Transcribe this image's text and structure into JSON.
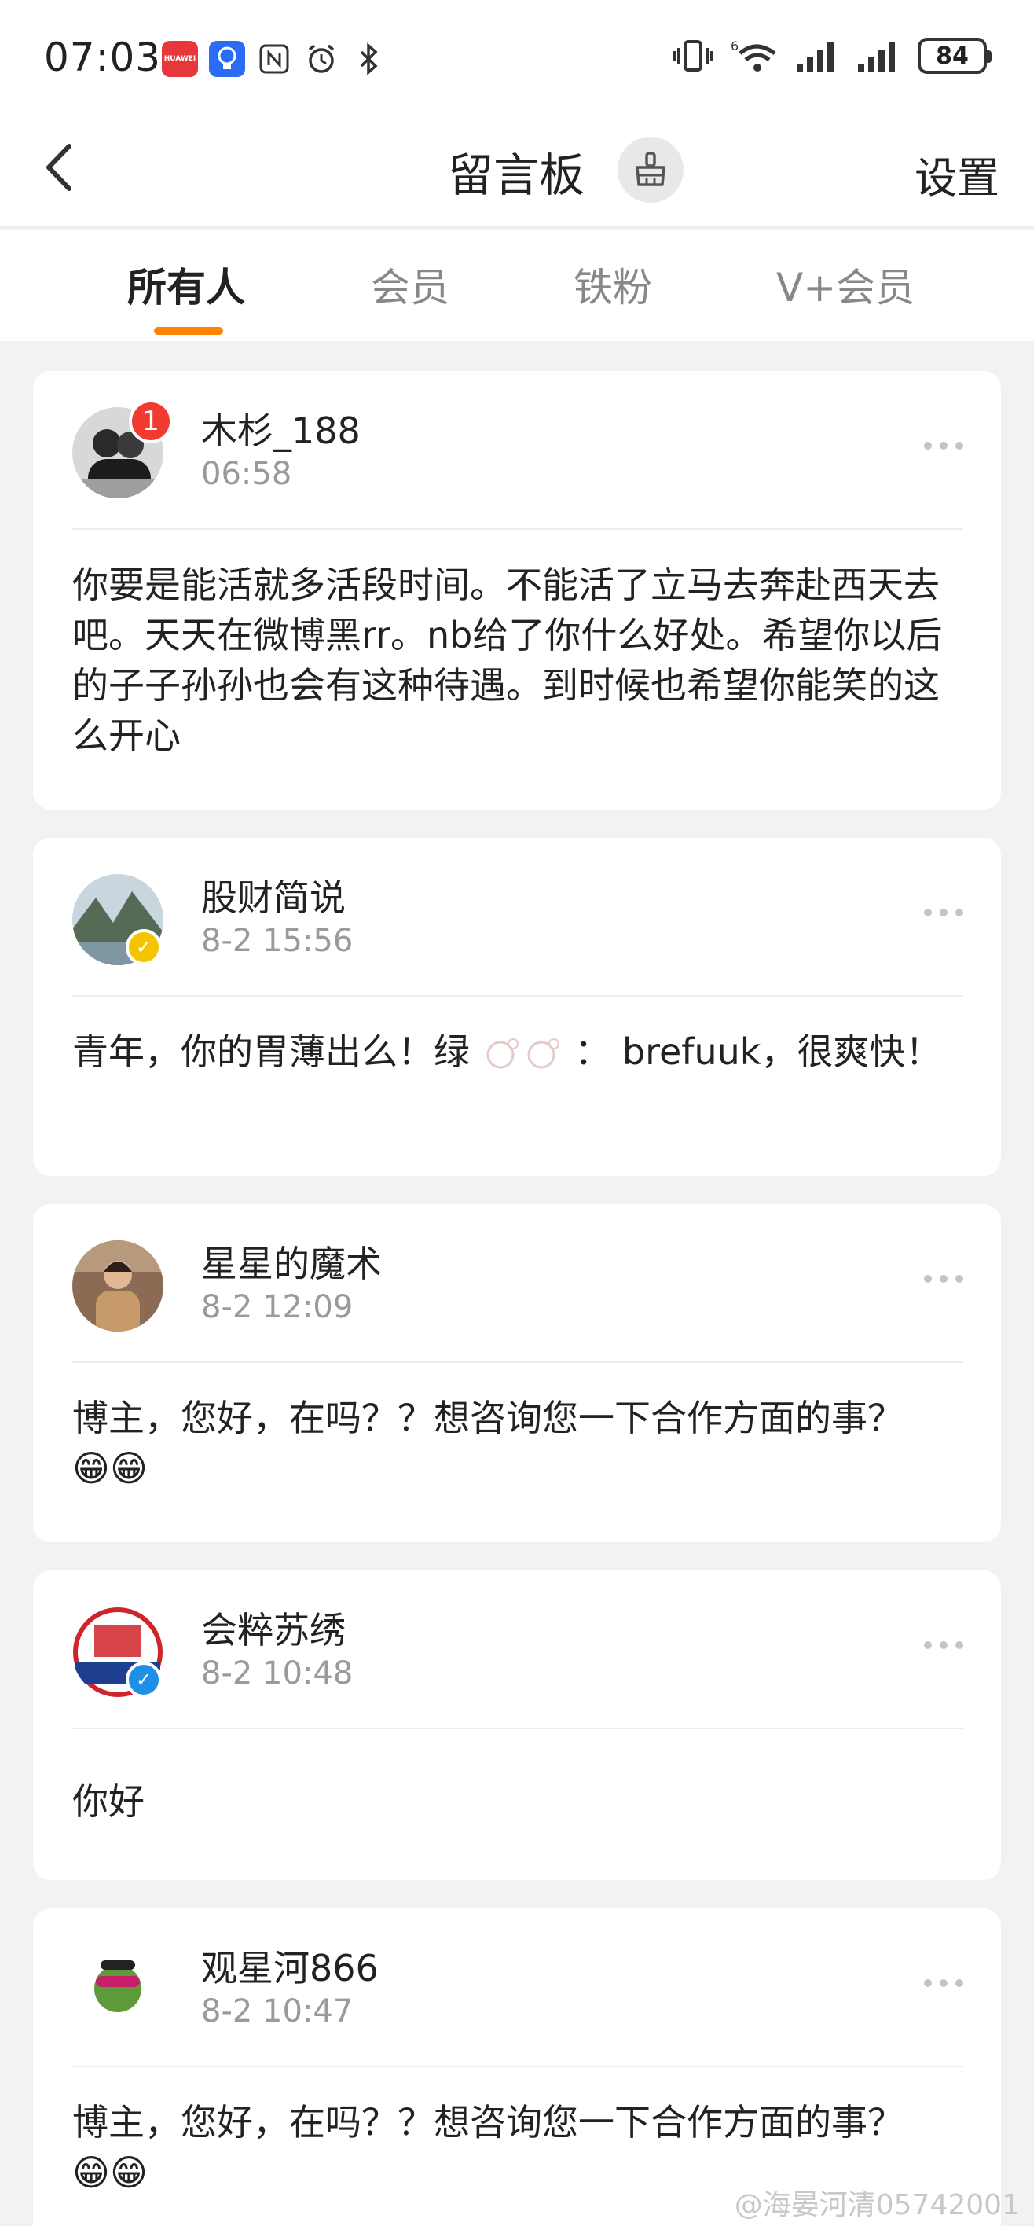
{
  "status_bar": {
    "time": "07:03",
    "app_icons": [
      "huawei-icon",
      "lightbulb-icon",
      "nfc-icon",
      "alarm-icon",
      "bluetooth-icon"
    ],
    "huawei_label": "HUAWEI",
    "battery": "84"
  },
  "header": {
    "title": "留言板",
    "settings_label": "设置"
  },
  "tabs": [
    {
      "label": "所有人",
      "active": true
    },
    {
      "label": "会员",
      "active": false
    },
    {
      "label": "铁粉",
      "active": false
    },
    {
      "label": "V+会员",
      "active": false
    }
  ],
  "messages": [
    {
      "name": "木杉_188",
      "time": "06:58",
      "badge": "1",
      "text": "你要是能活就多活段时间。不能活了立马去奔赴西天去吧。天天在微博黑rr。nb给了你什么好处。希望你以后的子子孙孙也会有这种待遇。到时候也希望你能笑的这么开心"
    },
    {
      "name": "股财简说",
      "time": "8-2 15:56",
      "text": "青年，你的胃薄出么！绿",
      "text_after": "：   brefuuk，很爽快！"
    },
    {
      "name": "星星的魔术",
      "time": "8-2 12:09",
      "text": "博主，您好，在吗？？想咨询您一下合作方面的事？",
      "emoji": "😁😁"
    },
    {
      "name": "会粹苏绣",
      "time": "8-2 10:48",
      "text": "你好"
    },
    {
      "name": "观星河866",
      "time": "8-2 10:47",
      "text": "博主，您好，在吗？？想咨询您一下合作方面的事？",
      "emoji": "😁😁"
    }
  ],
  "watermark": "@海晏河清05742001",
  "colors": {
    "accent": "#ff8200",
    "badge": "#f23b30",
    "verified_yellow": "#f5c400",
    "verified_blue": "#1e8fe6"
  }
}
